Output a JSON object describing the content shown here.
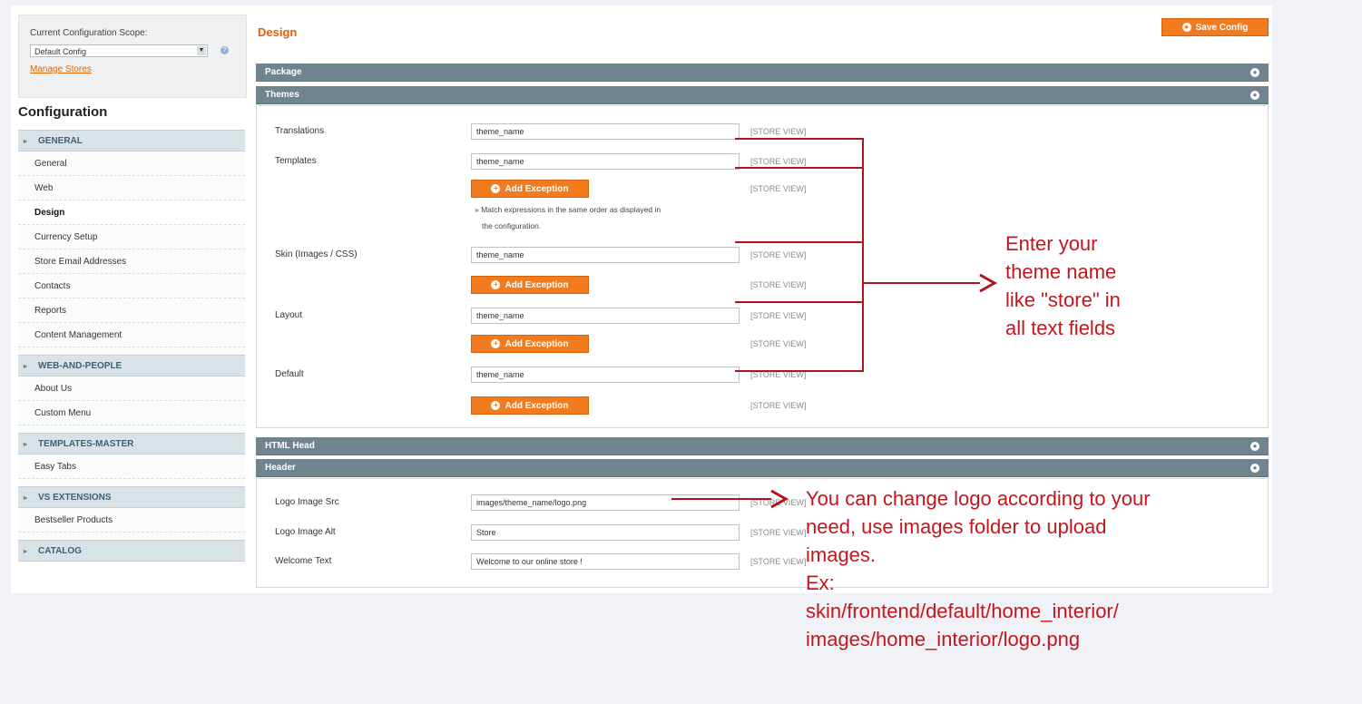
{
  "sidebar": {
    "scope_label": "Current Configuration Scope:",
    "scope_value": "Default Config",
    "manage_stores": "Manage Stores",
    "config_title": "Configuration",
    "groups": [
      {
        "label": "GENERAL",
        "items": [
          "General",
          "Web",
          "Design",
          "Currency Setup",
          "Store Email Addresses",
          "Contacts",
          "Reports",
          "Content Management"
        ]
      },
      {
        "label": "WEB-AND-PEOPLE",
        "items": [
          "About Us",
          "Custom Menu"
        ]
      },
      {
        "label": "TEMPLATES-MASTER",
        "items": [
          "Easy Tabs"
        ]
      },
      {
        "label": "VS EXTENSIONS",
        "items": [
          "Bestseller Products"
        ]
      },
      {
        "label": "CATALOG",
        "items": []
      }
    ],
    "active_item": "Design"
  },
  "main": {
    "title": "Design",
    "save_button": "Save Config",
    "sections": {
      "package": "Package",
      "themes": "Themes",
      "html_head": "HTML Head",
      "header": "Header"
    },
    "themes_fields": {
      "translations": {
        "label": "Translations",
        "value": "theme_name"
      },
      "templates": {
        "label": "Templates",
        "value": "theme_name"
      },
      "skin": {
        "label": "Skin (Images / CSS)",
        "value": "theme_name"
      },
      "layout": {
        "label": "Layout",
        "value": "theme_name"
      },
      "default": {
        "label": "Default",
        "value": "theme_name"
      }
    },
    "add_exception": "Add Exception",
    "store_view": "[STORE VIEW]",
    "note_line1": "Match expressions in the same order as displayed in",
    "note_line2": "the configuration.",
    "header_fields": {
      "logo_src": {
        "label": "Logo Image Src",
        "value": "images/theme_name/logo.png"
      },
      "logo_alt": {
        "label": "Logo Image Alt",
        "value": "Store"
      },
      "welcome": {
        "label": "Welcome Text",
        "value": "Welcome to our online store !"
      }
    }
  },
  "annotations": {
    "theme_note": [
      "Enter your",
      "theme name",
      "like \"store\" in",
      "all text fields"
    ],
    "logo_note": [
      "You can change logo according to your",
      "need, use images folder to upload",
      "images.",
      "Ex:",
      "skin/frontend/default/home_interior/",
      "images/home_interior/logo.png"
    ]
  },
  "colors": {
    "accent": "#f37b1f",
    "section_header": "#6f848f",
    "annotation": "#c4161c",
    "title": "#eb5e00"
  }
}
